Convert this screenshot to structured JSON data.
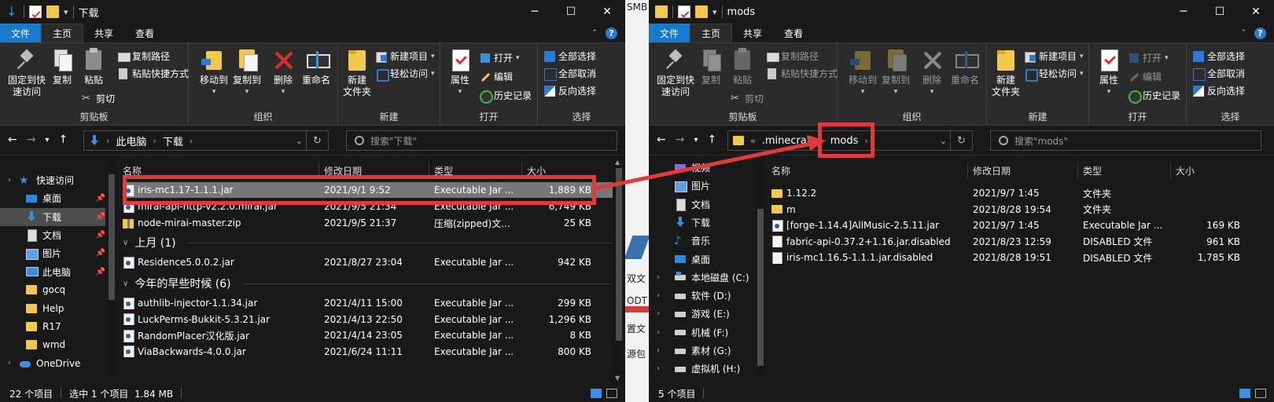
{
  "left": {
    "title": "下载",
    "tabs": [
      "文件",
      "主页",
      "共享",
      "查看"
    ],
    "ribbon": {
      "pin": "固定到快\n速访问",
      "copy": "复制",
      "paste": "粘贴",
      "copy_path": "复制路径",
      "paste_shortcut": "粘贴快捷方式",
      "cut": "剪切",
      "clipboard": "剪贴板",
      "move_to": "移动到",
      "copy_to": "复制到",
      "delete": "删除",
      "rename": "重命名",
      "organize": "组织",
      "new_folder": "新建\n文件夹",
      "new_item": "新建项目",
      "easy_access": "轻松访问",
      "new": "新建",
      "properties": "属性",
      "open_btn": "打开",
      "edit": "编辑",
      "history": "历史记录",
      "open_group": "打开",
      "select_all": "全部选择",
      "select_none": "全部取消",
      "invert": "反向选择",
      "select_group": "选择"
    },
    "path": [
      "此电脑",
      "下载"
    ],
    "search_placeholder": "搜索\"下载\"",
    "columns": [
      "名称",
      "修改日期",
      "类型",
      "大小"
    ],
    "nav": [
      {
        "label": "快速访问",
        "icon": "star-icon"
      },
      {
        "label": "桌面",
        "icon": "desktop-icon"
      },
      {
        "label": "下载",
        "icon": "download-icon"
      },
      {
        "label": "文档",
        "icon": "document-icon"
      },
      {
        "label": "图片",
        "icon": "pictures-icon"
      },
      {
        "label": "此电脑",
        "icon": "pc-icon"
      },
      {
        "label": "gocq",
        "icon": "folder-icon"
      },
      {
        "label": "Help",
        "icon": "folder-icon"
      },
      {
        "label": "R17",
        "icon": "folder-icon"
      },
      {
        "label": "wmd",
        "icon": "folder-icon"
      },
      {
        "label": "OneDrive",
        "icon": "onedrive-icon"
      }
    ],
    "files_top": [
      {
        "name": "iris-mc1.17-1.1.1.jar",
        "date": "2021/9/1 9:52",
        "type": "Executable Jar ...",
        "size": "1,889 KB",
        "icon": "jar"
      },
      {
        "name": "mirai-api-http-v2.2.0.mirai.jar",
        "date": "2021/9/5 21:34",
        "type": "Executable Jar ...",
        "size": "6,749 KB",
        "icon": "jar"
      },
      {
        "name": "node-mirai-master.zip",
        "date": "2021/9/5 21:37",
        "type": "压缩(zipped)文...",
        "size": "25 KB",
        "icon": "zip"
      }
    ],
    "group1": "上月 (1)",
    "files_g1": [
      {
        "name": "Residence5.0.0.2.jar",
        "date": "2021/8/27 23:04",
        "type": "Executable Jar ...",
        "size": "942 KB",
        "icon": "jar"
      }
    ],
    "group2": "今年的早些时候 (6)",
    "files_g2": [
      {
        "name": "authlib-injector-1.1.34.jar",
        "date": "2021/4/11 15:00",
        "type": "Executable Jar ...",
        "size": "299 KB",
        "icon": "jar"
      },
      {
        "name": "LuckPerms-Bukkit-5.3.21.jar",
        "date": "2021/4/13 22:50",
        "type": "Executable Jar ...",
        "size": "1,296 KB",
        "icon": "jar"
      },
      {
        "name": "RandomPlacer汉化版.jar",
        "date": "2021/4/14 23:05",
        "type": "Executable Jar ...",
        "size": "8 KB",
        "icon": "jar"
      },
      {
        "name": "ViaBackwards-4.0.0.jar",
        "date": "2021/6/24 11:11",
        "type": "Executable Jar ...",
        "size": "800 KB",
        "icon": "jar"
      }
    ],
    "status": {
      "count": "22 个项目",
      "selected": "选中 1 个项目  1.84 MB"
    }
  },
  "right": {
    "title": "mods",
    "tabs": [
      "文件",
      "主页",
      "共享",
      "查看"
    ],
    "path": [
      ".minecraft",
      "mods"
    ],
    "path_prefix": "«",
    "search_placeholder": "搜索\"mods\"",
    "columns": [
      "名称",
      "修改日期",
      "类型",
      "大小"
    ],
    "nav": [
      {
        "label": "视频",
        "icon": "video-icon"
      },
      {
        "label": "图片",
        "icon": "pictures-icon"
      },
      {
        "label": "文档",
        "icon": "document-icon"
      },
      {
        "label": "下载",
        "icon": "download-icon"
      },
      {
        "label": "音乐",
        "icon": "music-icon"
      },
      {
        "label": "桌面",
        "icon": "desktop-icon"
      },
      {
        "label": "本地磁盘 (C:)",
        "icon": "drive-c-icon"
      },
      {
        "label": "软件 (D:)",
        "icon": "drive-icon"
      },
      {
        "label": "游戏 (E:)",
        "icon": "drive-icon"
      },
      {
        "label": "机械 (F:)",
        "icon": "drive-icon"
      },
      {
        "label": "素材 (G:)",
        "icon": "drive-icon"
      },
      {
        "label": "虚拟机 (H:)",
        "icon": "drive-icon"
      }
    ],
    "files": [
      {
        "name": "1.12.2",
        "date": "2021/9/7 1:45",
        "type": "文件夹",
        "size": "",
        "icon": "fold"
      },
      {
        "name": "m",
        "date": "2021/8/28 19:54",
        "type": "文件夹",
        "size": "",
        "icon": "fold"
      },
      {
        "name": "[forge-1.14.4]AllMusic-2.5.11.jar",
        "date": "2021/9/7 1:45",
        "type": "Executable Jar ...",
        "size": "169 KB",
        "icon": "jar"
      },
      {
        "name": "fabric-api-0.37.2+1.16.jar.disabled",
        "date": "2021/8/23 12:59",
        "type": "DISABLED 文件",
        "size": "961 KB",
        "icon": "blank"
      },
      {
        "name": "iris-mc1.16.5-1.1.1.jar.disabled",
        "date": "2021/8/28 19:51",
        "type": "DISABLED 文件",
        "size": "1,785 KB",
        "icon": "blank"
      }
    ],
    "status": {
      "count": "5 个项目"
    }
  },
  "background_fragments": [
    "SMB",
    "双文",
    "ODT",
    "置文",
    "源包"
  ],
  "colors": {
    "accent": "#1979ca",
    "annotation": "#e13a3a",
    "selected_row": "#777777",
    "folder": "#f1c84b"
  }
}
